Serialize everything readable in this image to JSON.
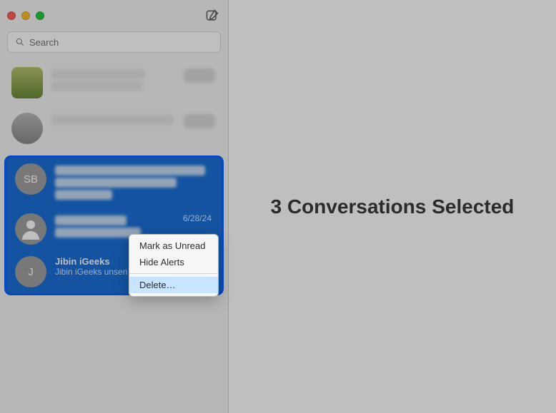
{
  "search": {
    "placeholder": "Search"
  },
  "conversations": {
    "sb": {
      "initials": "SB"
    },
    "item4": {
      "date": "6/28/24"
    },
    "item5": {
      "initials": "J",
      "name": "Jibin iGeeks",
      "preview": "Jibin iGeeks unsen"
    }
  },
  "context_menu": {
    "mark_unread": "Mark as Unread",
    "hide_alerts": "Hide Alerts",
    "delete": "Delete…"
  },
  "main": {
    "headline": "3 Conversations Selected"
  }
}
